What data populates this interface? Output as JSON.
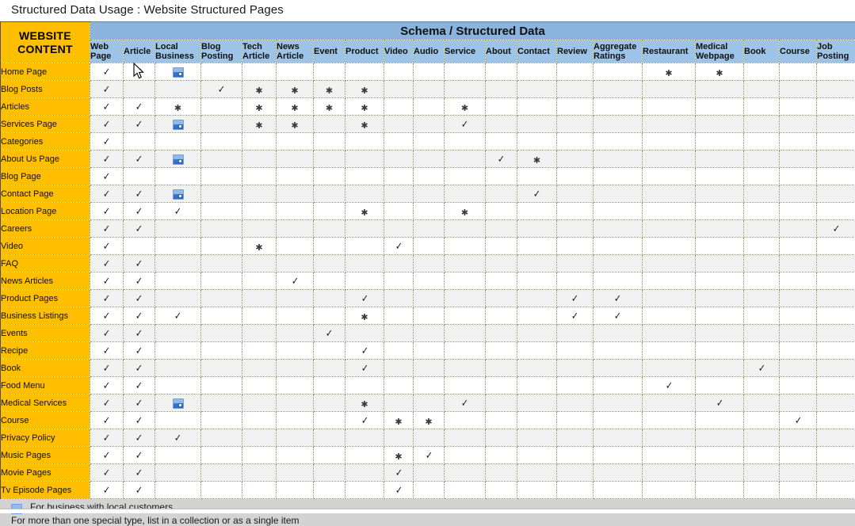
{
  "page": {
    "title": "Structured Data Usage : Website Structured Pages"
  },
  "table": {
    "corner_line1": "WEBSITE",
    "corner_line2": "CONTENT",
    "schema_banner": "Schema / Structured Data",
    "columns": [
      "Web Page",
      "Article",
      "Local Business",
      "Blog Posting",
      "Tech Article",
      "News Article",
      "Event",
      "Product",
      "Video",
      "Audio",
      "Service",
      "About",
      "Contact",
      "Review",
      "Aggregate Ratings",
      "Restaurant",
      "Medical Webpage",
      "Book",
      "Course",
      "Job Posting"
    ],
    "rows": [
      {
        "label": "Home Page",
        "cells": [
          "check",
          "check",
          "gmb",
          "",
          "",
          "",
          "",
          "",
          "",
          "",
          "",
          "",
          "",
          "",
          "",
          "star",
          "star",
          "",
          "",
          ""
        ]
      },
      {
        "label": "Blog Posts",
        "cells": [
          "check",
          "",
          "",
          "check",
          "star",
          "star",
          "star",
          "star",
          "",
          "",
          "",
          "",
          "",
          "",
          "",
          "",
          "",
          "",
          "",
          ""
        ]
      },
      {
        "label": "Articles",
        "cells": [
          "check",
          "check",
          "star",
          "",
          "star",
          "star",
          "star",
          "star",
          "",
          "",
          "star",
          "",
          "",
          "",
          "",
          "",
          "",
          "",
          "",
          ""
        ]
      },
      {
        "label": "Services Page",
        "cells": [
          "check",
          "check",
          "gmb",
          "",
          "star",
          "star",
          "",
          "star",
          "",
          "",
          "check",
          "",
          "",
          "",
          "",
          "",
          "",
          "",
          "",
          ""
        ]
      },
      {
        "label": "Categories",
        "cells": [
          "check",
          "",
          "",
          "",
          "",
          "",
          "",
          "",
          "",
          "",
          "",
          "",
          "",
          "",
          "",
          "",
          "",
          "",
          "",
          ""
        ]
      },
      {
        "label": "About Us Page",
        "cells": [
          "check",
          "check",
          "gmb",
          "",
          "",
          "",
          "",
          "",
          "",
          "",
          "",
          "check",
          "star",
          "",
          "",
          "",
          "",
          "",
          "",
          ""
        ]
      },
      {
        "label": "Blog Page",
        "cells": [
          "check",
          "",
          "",
          "",
          "",
          "",
          "",
          "",
          "",
          "",
          "",
          "",
          "",
          "",
          "",
          "",
          "",
          "",
          "",
          ""
        ]
      },
      {
        "label": "Contact Page",
        "cells": [
          "check",
          "check",
          "gmb",
          "",
          "",
          "",
          "",
          "",
          "",
          "",
          "",
          "",
          "check",
          "",
          "",
          "",
          "",
          "",
          "",
          ""
        ]
      },
      {
        "label": "Location Page",
        "cells": [
          "check",
          "check",
          "check",
          "",
          "",
          "",
          "",
          "star",
          "",
          "",
          "star",
          "",
          "",
          "",
          "",
          "",
          "",
          "",
          "",
          ""
        ]
      },
      {
        "label": "Careers",
        "cells": [
          "check",
          "check",
          "",
          "",
          "",
          "",
          "",
          "",
          "",
          "",
          "",
          "",
          "",
          "",
          "",
          "",
          "",
          "",
          "",
          "check"
        ]
      },
      {
        "label": "Video",
        "cells": [
          "check",
          "",
          "",
          "",
          "star",
          "",
          "",
          "",
          "check",
          "",
          "",
          "",
          "",
          "",
          "",
          "",
          "",
          "",
          "",
          ""
        ]
      },
      {
        "label": "FAQ",
        "cells": [
          "check",
          "check",
          "",
          "",
          "",
          "",
          "",
          "",
          "",
          "",
          "",
          "",
          "",
          "",
          "",
          "",
          "",
          "",
          "",
          ""
        ]
      },
      {
        "label": "News Articles",
        "cells": [
          "check",
          "check",
          "",
          "",
          "",
          "check",
          "",
          "",
          "",
          "",
          "",
          "",
          "",
          "",
          "",
          "",
          "",
          "",
          "",
          ""
        ]
      },
      {
        "label": "Product Pages",
        "cells": [
          "check",
          "check",
          "",
          "",
          "",
          "",
          "",
          "check",
          "",
          "",
          "",
          "",
          "",
          "check",
          "check",
          "",
          "",
          "",
          "",
          ""
        ]
      },
      {
        "label": "Business Listings",
        "cells": [
          "check",
          "check",
          "check",
          "",
          "",
          "",
          "",
          "star",
          "",
          "",
          "",
          "",
          "",
          "check",
          "check",
          "",
          "",
          "",
          "",
          ""
        ]
      },
      {
        "label": "Events",
        "cells": [
          "check",
          "check",
          "",
          "",
          "",
          "",
          "check",
          "",
          "",
          "",
          "",
          "",
          "",
          "",
          "",
          "",
          "",
          "",
          "",
          ""
        ]
      },
      {
        "label": "Recipe",
        "cells": [
          "check",
          "check",
          "",
          "",
          "",
          "",
          "",
          "check",
          "",
          "",
          "",
          "",
          "",
          "",
          "",
          "",
          "",
          "",
          "",
          ""
        ]
      },
      {
        "label": "Book",
        "cells": [
          "check",
          "check",
          "",
          "",
          "",
          "",
          "",
          "check",
          "",
          "",
          "",
          "",
          "",
          "",
          "",
          "",
          "",
          "check",
          "",
          ""
        ]
      },
      {
        "label": "Food Menu",
        "cells": [
          "check",
          "check",
          "",
          "",
          "",
          "",
          "",
          "",
          "",
          "",
          "",
          "",
          "",
          "",
          "",
          "check",
          "",
          "",
          "",
          ""
        ]
      },
      {
        "label": "Medical Services",
        "cells": [
          "check",
          "check",
          "gmb",
          "",
          "",
          "",
          "",
          "star",
          "",
          "",
          "check",
          "",
          "",
          "",
          "",
          "",
          "check",
          "",
          "",
          ""
        ]
      },
      {
        "label": "Course",
        "cells": [
          "check",
          "check",
          "",
          "",
          "",
          "",
          "",
          "check",
          "star",
          "star",
          "",
          "",
          "",
          "",
          "",
          "",
          "",
          "",
          "check",
          ""
        ]
      },
      {
        "label": "Privacy Policy",
        "cells": [
          "check",
          "check",
          "check",
          "",
          "",
          "",
          "",
          "",
          "",
          "",
          "",
          "",
          "",
          "",
          "",
          "",
          "",
          "",
          "",
          ""
        ]
      },
      {
        "label": "Music Pages",
        "cells": [
          "check",
          "check",
          "",
          "",
          "",
          "",
          "",
          "",
          "star",
          "check",
          "",
          "",
          "",
          "",
          "",
          "",
          "",
          "",
          "",
          ""
        ]
      },
      {
        "label": "Movie Pages",
        "cells": [
          "check",
          "check",
          "",
          "",
          "",
          "",
          "",
          "",
          "check",
          "",
          "",
          "",
          "",
          "",
          "",
          "",
          "",
          "",
          "",
          ""
        ]
      },
      {
        "label": "Tv Episode Pages",
        "cells": [
          "check",
          "check",
          "",
          "",
          "",
          "",
          "",
          "",
          "check",
          "",
          "",
          "",
          "",
          "",
          "",
          "",
          "",
          "",
          "",
          ""
        ]
      }
    ]
  },
  "legend": {
    "icon_name": "google-my-business-icon",
    "line1": "For business with local customers",
    "line2": "For more than one special type, list in a collection or as a single item"
  },
  "glyphs": {
    "check": "✓",
    "star": "✱"
  },
  "colors": {
    "header_blue": "#9dc3e6",
    "banner_blue": "#8ab3dd",
    "label_yellow": "#FFBE00",
    "grid_line": "#8aa36d",
    "alt_row": "#f1f1f1",
    "footer_grey": "#d3d3d3"
  }
}
